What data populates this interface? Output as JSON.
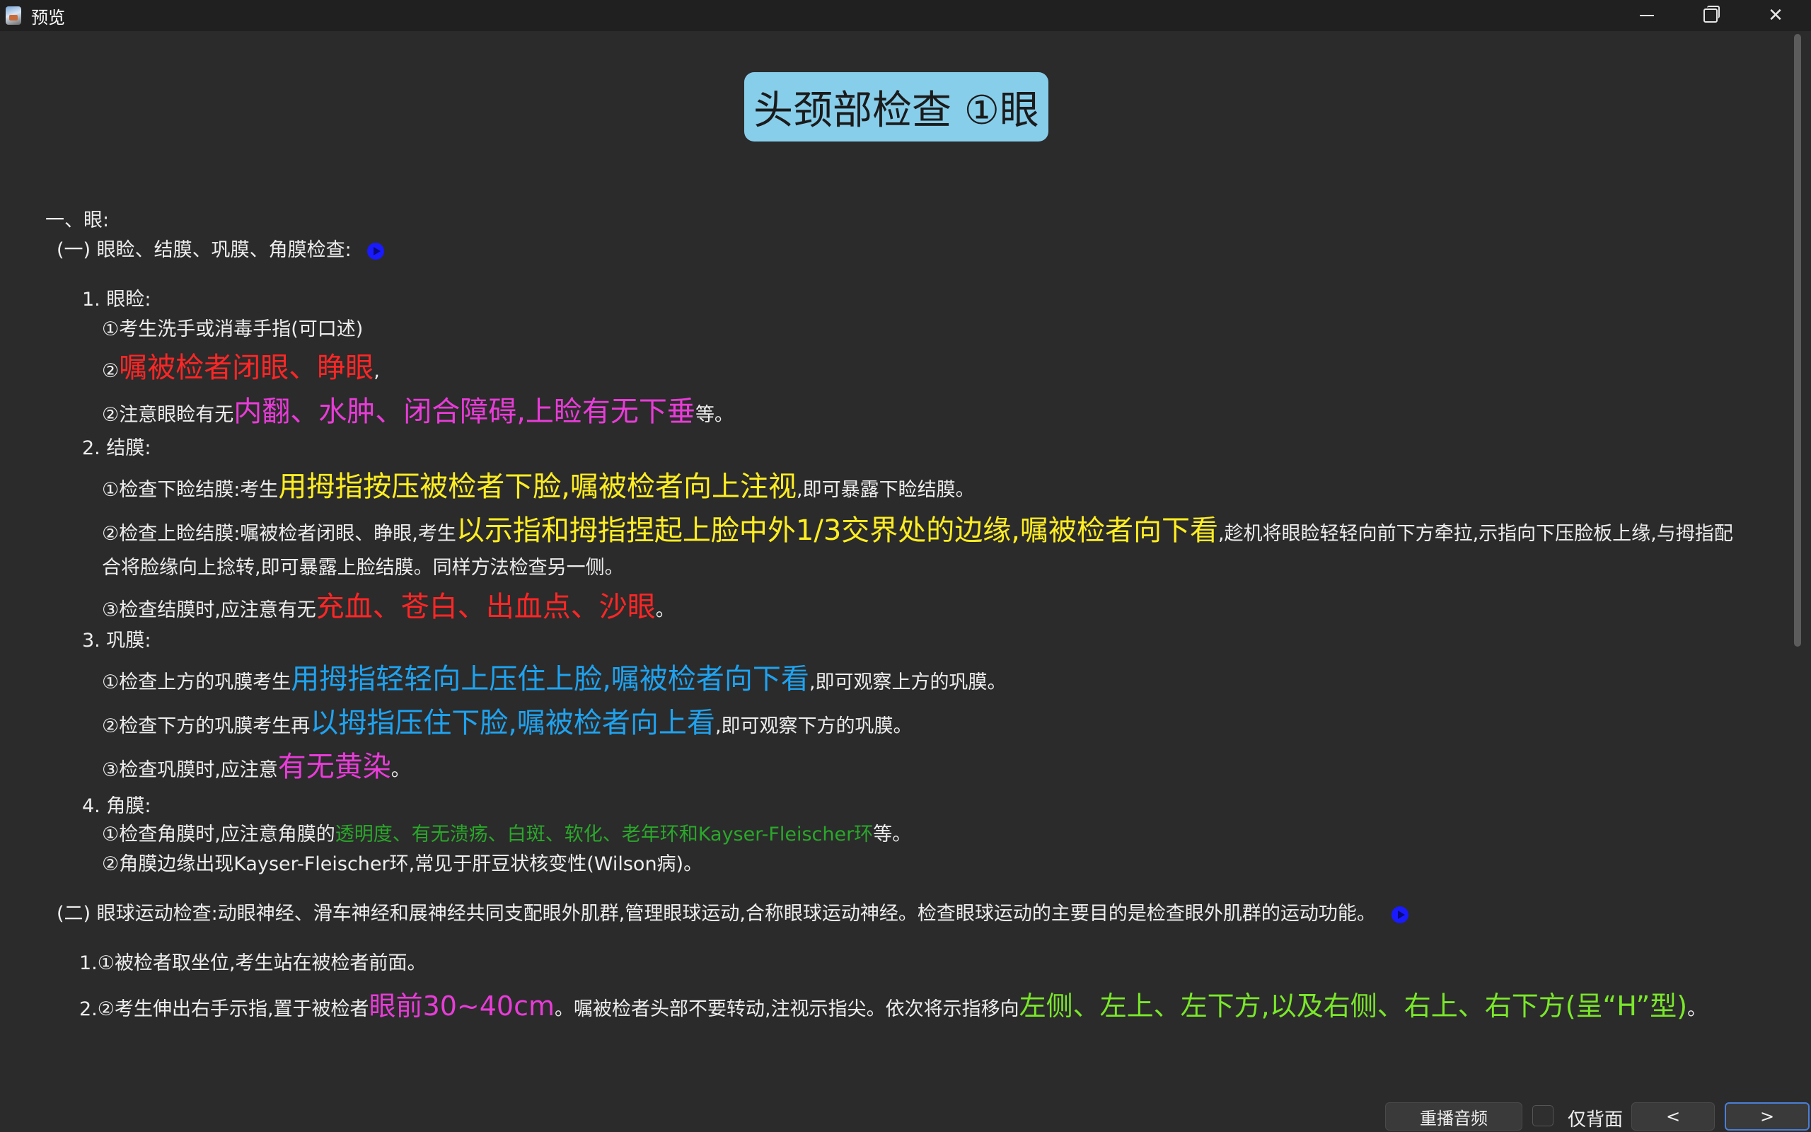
{
  "window": {
    "title": "预览"
  },
  "doc_title": "头颈部检查 ①眼",
  "section1": {
    "heading": "一、眼:",
    "sub1": "(一) 眼睑、结膜、巩膜、角膜检查:",
    "eyelid": {
      "label": "1. 眼睑:",
      "l1": "①考生洗手或消毒手指(可口述)",
      "l2_prefix": "②",
      "l2_hl": "嘱被检者闭眼、睁眼",
      "l2_suffix": ",",
      "l3_prefix": "②注意眼睑有无",
      "l3_hl": "内翻、水肿、闭合障碍,上睑有无下垂",
      "l3_suffix": "等。"
    },
    "conj": {
      "label": "2. 结膜:",
      "l1_prefix": "①检查下睑结膜:考生",
      "l1_hl": "用拇指按压被检者下脸,嘱被检者向上注视",
      "l1_suffix": ",即可暴露下睑结膜。",
      "l2_prefix": "②检查上睑结膜:嘱被检者闭眼、睁眼,考生",
      "l2_hl": "以示指和拇指捏起上脸中外1/3交界处的边缘,嘱被检者向下看",
      "l2_suffix": ",趁机将眼睑轻轻向前下方牵拉,示指向下压脸板上缘,与拇指配合将脸缘向上捻转,即可暴露上脸结膜。同样方法检查另一侧。",
      "l3_prefix": "③检查结膜时,应注意有无",
      "l3_hl": "充血、苍白、出血点、沙眼",
      "l3_suffix": "。"
    },
    "sclera": {
      "label": "3. 巩膜:",
      "l1_prefix": "①检查上方的巩膜考生",
      "l1_hl": "用拇指轻轻向上压住上脸,嘱被检者向下看",
      "l1_suffix": ",即可观察上方的巩膜。",
      "l2_prefix": "②检查下方的巩膜考生再",
      "l2_hl": "以拇指压住下脸,嘱被检者向上看",
      "l2_suffix": ",即可观察下方的巩膜。",
      "l3_prefix": "③检查巩膜时,应注意",
      "l3_hl": "有无黄染",
      "l3_suffix": "。"
    },
    "cornea": {
      "label": "4. 角膜:",
      "l1_prefix": "①检查角膜时,应注意角膜的",
      "l1_hl": "透明度、有无溃疡、白斑、软化、老年环和Kayser-Fleischer环",
      "l1_suffix": "等。",
      "l2": "②角膜边缘出现Kayser-Fleischer环,常见于肝豆状核变性(Wilson病)。"
    }
  },
  "section2": {
    "sub2": "(二) 眼球运动检查:动眼神经、滑车神经和展神经共同支配眼外肌群,管理眼球运动,合称眼球运动神经。检查眼球运动的主要目的是检查眼外肌群的运动功能。",
    "i1_num": "1.",
    "i1": "①被检者取坐位,考生站在被检者前面。",
    "i2_num": "2.",
    "i2_prefix": "②考生伸出右手示指,置于被检者",
    "i2_hl1": "眼前30~40cm",
    "i2_mid": "。嘱被检者头部不要转动,注视示指尖。依次将示指移向",
    "i2_hl2": "左侧、左上、左下方,以及右侧、右上、右下方(呈“H”型)",
    "i2_suffix": "。"
  },
  "controls": {
    "replay": "重播音频",
    "back_only": "仅背面",
    "prev": "<",
    "next": ">"
  },
  "icons": {
    "play": "play-icon",
    "app": "app-icon"
  }
}
